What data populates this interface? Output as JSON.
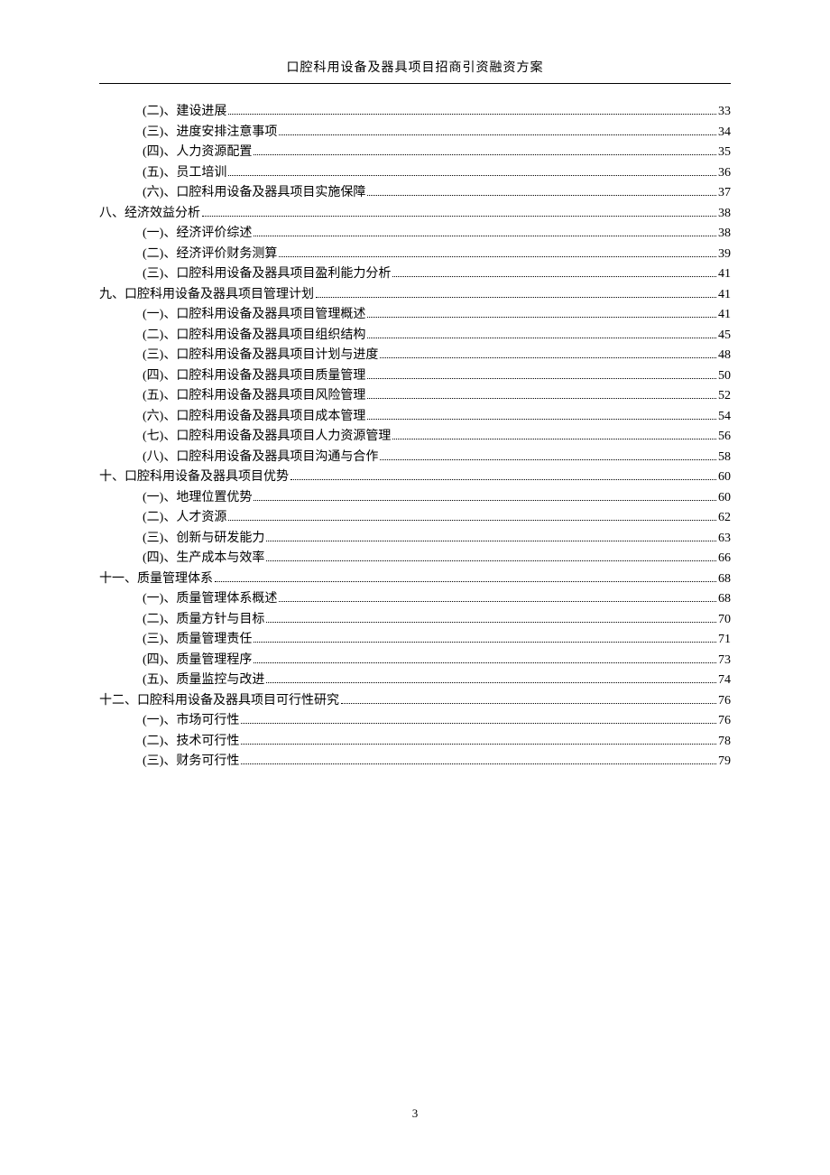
{
  "header": "口腔科用设备及器具项目招商引资融资方案",
  "page_number": "3",
  "toc": [
    {
      "level": 2,
      "label": "(二)、建设进展",
      "page": "33"
    },
    {
      "level": 2,
      "label": "(三)、进度安排注意事项",
      "page": "34"
    },
    {
      "level": 2,
      "label": "(四)、人力资源配置",
      "page": "35"
    },
    {
      "level": 2,
      "label": "(五)、员工培训",
      "page": "36"
    },
    {
      "level": 2,
      "label": "(六)、口腔科用设备及器具项目实施保障",
      "page": "37"
    },
    {
      "level": 1,
      "label": "八、经济效益分析",
      "page": "38"
    },
    {
      "level": 2,
      "label": "(一)、经济评价综述",
      "page": "38"
    },
    {
      "level": 2,
      "label": "(二)、经济评价财务测算",
      "page": "39"
    },
    {
      "level": 2,
      "label": "(三)、口腔科用设备及器具项目盈利能力分析",
      "page": "41"
    },
    {
      "level": 1,
      "label": "九、口腔科用设备及器具项目管理计划",
      "page": "41"
    },
    {
      "level": 2,
      "label": "(一)、口腔科用设备及器具项目管理概述",
      "page": "41"
    },
    {
      "level": 2,
      "label": "(二)、口腔科用设备及器具项目组织结构",
      "page": "45"
    },
    {
      "level": 2,
      "label": "(三)、口腔科用设备及器具项目计划与进度",
      "page": "48"
    },
    {
      "level": 2,
      "label": "(四)、口腔科用设备及器具项目质量管理",
      "page": "50"
    },
    {
      "level": 2,
      "label": "(五)、口腔科用设备及器具项目风险管理",
      "page": "52"
    },
    {
      "level": 2,
      "label": "(六)、口腔科用设备及器具项目成本管理",
      "page": "54"
    },
    {
      "level": 2,
      "label": "(七)、口腔科用设备及器具项目人力资源管理",
      "page": "56"
    },
    {
      "level": 2,
      "label": "(八)、口腔科用设备及器具项目沟通与合作",
      "page": "58"
    },
    {
      "level": 1,
      "label": "十、口腔科用设备及器具项目优势",
      "page": "60"
    },
    {
      "level": 2,
      "label": "(一)、地理位置优势",
      "page": "60"
    },
    {
      "level": 2,
      "label": "(二)、人才资源",
      "page": "62"
    },
    {
      "level": 2,
      "label": "(三)、创新与研发能力",
      "page": "63"
    },
    {
      "level": 2,
      "label": "(四)、生产成本与效率",
      "page": "66"
    },
    {
      "level": 1,
      "label": "十一、质量管理体系",
      "page": "68"
    },
    {
      "level": 2,
      "label": "(一)、质量管理体系概述",
      "page": "68"
    },
    {
      "level": 2,
      "label": "(二)、质量方针与目标",
      "page": "70"
    },
    {
      "level": 2,
      "label": "(三)、质量管理责任",
      "page": "71"
    },
    {
      "level": 2,
      "label": "(四)、质量管理程序",
      "page": "73"
    },
    {
      "level": 2,
      "label": "(五)、质量监控与改进",
      "page": "74"
    },
    {
      "level": 1,
      "label": "十二、口腔科用设备及器具项目可行性研究",
      "page": "76"
    },
    {
      "level": 2,
      "label": "(一)、市场可行性",
      "page": "76"
    },
    {
      "level": 2,
      "label": "(二)、技术可行性",
      "page": "78"
    },
    {
      "level": 2,
      "label": "(三)、财务可行性",
      "page": "79"
    }
  ]
}
